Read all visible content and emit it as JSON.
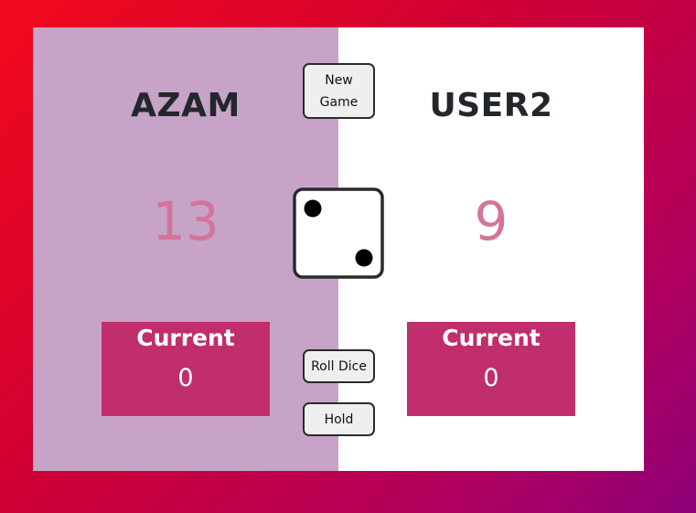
{
  "players": [
    {
      "name": "AZAM",
      "score": "13",
      "current_label": "Current",
      "current_score": "0",
      "active": true
    },
    {
      "name": "USER2",
      "score": "9",
      "current_label": "Current",
      "current_score": "0",
      "active": false
    }
  ],
  "controls": {
    "new_game": "New Game",
    "roll_dice": "Roll Dice",
    "hold": "Hold"
  },
  "dice": {
    "value": 2,
    "icon": "dice-two-icon"
  },
  "colors": {
    "active_panel": "#c7a3c7",
    "inactive_panel": "#ffffff",
    "score": "#d4749a",
    "current_box": "#c02e6d",
    "name_text": "#23272b",
    "background_start": "#f20a1c",
    "background_end": "#8e0078"
  }
}
